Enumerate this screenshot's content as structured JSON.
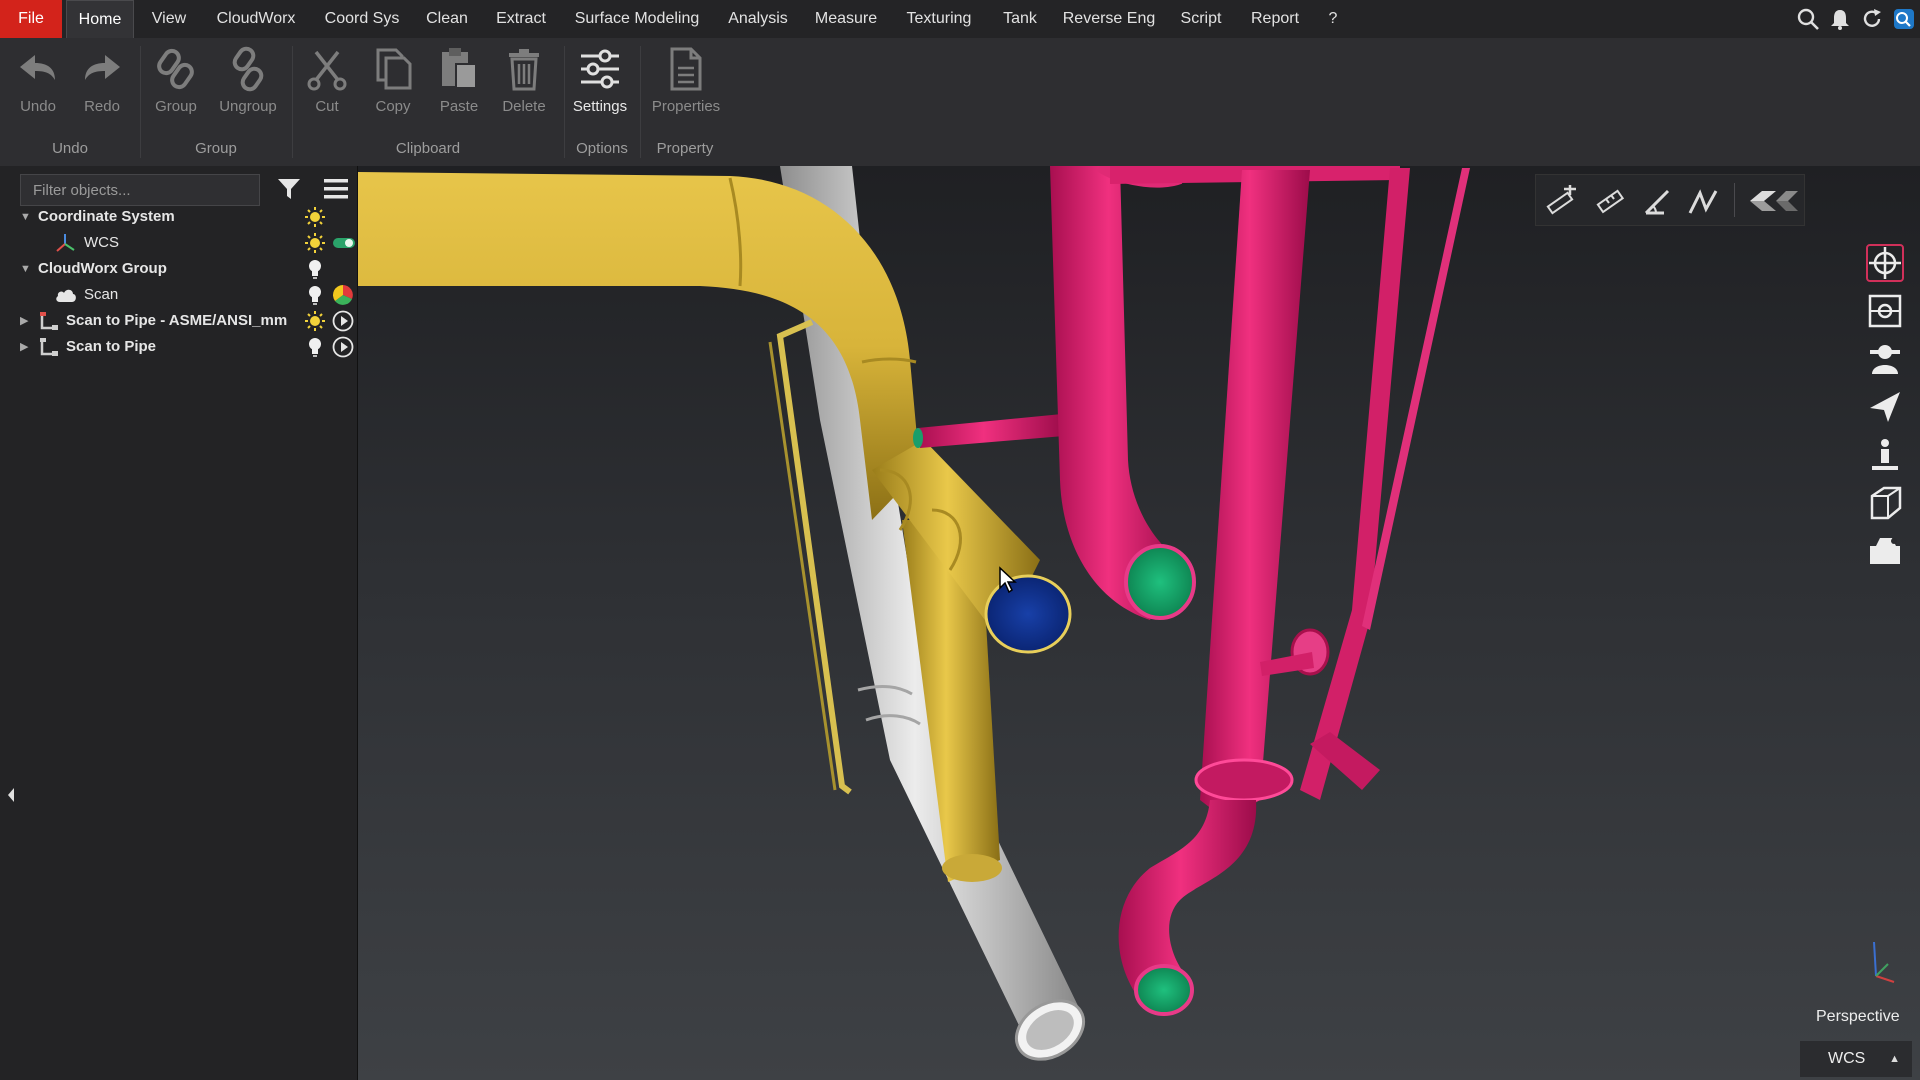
{
  "menu": {
    "file": "File",
    "tabs": [
      "Home",
      "View",
      "CloudWorx",
      "Coord Sys",
      "Clean",
      "Extract",
      "Surface Modeling",
      "Analysis",
      "Measure",
      "Texturing",
      "Tank",
      "Reverse Eng",
      "Script",
      "Report",
      "?"
    ],
    "active_tab": "Home"
  },
  "ribbon": {
    "buttons": {
      "undo": "Undo",
      "redo": "Redo",
      "group": "Group",
      "ungroup": "Ungroup",
      "cut": "Cut",
      "copy": "Copy",
      "paste": "Paste",
      "delete": "Delete",
      "settings": "Settings",
      "properties": "Properties"
    },
    "groups": {
      "undo": "Undo",
      "group": "Group",
      "clipboard": "Clipboard",
      "options": "Options",
      "property": "Property"
    }
  },
  "panel": {
    "filter_placeholder": "Filter objects...",
    "tree": [
      {
        "label": "Coordinate System"
      },
      {
        "label": "WCS"
      },
      {
        "label": "CloudWorx Group"
      },
      {
        "label": "Scan"
      },
      {
        "label": "Scan to Pipe - ASME/ANSI_mm"
      },
      {
        "label": "Scan to Pipe"
      }
    ]
  },
  "viewport": {
    "projection": "Perspective",
    "coord_system": "WCS"
  },
  "colors": {
    "file_tab": "#d3231b",
    "pipe_yellow": "#d4b13a",
    "pipe_magenta": "#e01d73",
    "pipe_white": "#d8d8d8",
    "cap_green": "#1a9e6a",
    "cap_blue": "#0e2e8e",
    "accent_red": "#d1305a"
  },
  "icons": {
    "top_right": [
      "search-icon",
      "bell-icon",
      "refresh-icon",
      "app-icon"
    ],
    "tree_status": [
      "sun-icon",
      "toggle-icon",
      "bulb-icon",
      "color-wheel-icon",
      "play-icon"
    ],
    "right_toolbar": [
      "orbit-icon",
      "fit-view-icon",
      "walk-icon",
      "fly-icon",
      "person-icon",
      "box-view-icon",
      "camera-icon"
    ]
  }
}
